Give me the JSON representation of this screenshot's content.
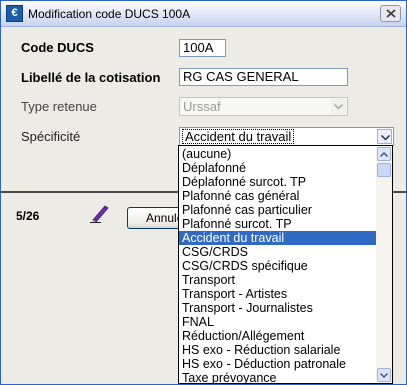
{
  "window": {
    "title": "Modification code DUCS 100A"
  },
  "form": {
    "code_label": "Code DUCS",
    "code_value": "100A",
    "libelle_label": "Libellé de la cotisation",
    "libelle_value": "RG CAS GENERAL",
    "type_label": "Type retenue",
    "type_value": "Urssaf",
    "specificite_label": "Spécificité",
    "specificite_value": "Accident du travail"
  },
  "footer": {
    "counter": "5/26",
    "cancel_label": "Annuler"
  },
  "dropdown": {
    "selected_index": 6,
    "items": [
      "(aucune)",
      "Déplafonné",
      "Déplafonné surcot. TP",
      "Plafonné cas général",
      "Plafonné cas particulier",
      "Plafonné surcot. TP",
      "Accident du travail",
      "CSG/CRDS",
      "CSG/CRDS spécifique",
      "Transport",
      "Transport - Artistes",
      "Transport - Journalistes",
      "FNAL",
      "Réduction/Allégement",
      "HS exo - Réduction salariale",
      "HS exo - Déduction patronale",
      "Taxe prévoyance"
    ]
  },
  "icons": {
    "app": "app-icon",
    "close": "close-icon",
    "edit": "pencil-icon",
    "combo_arrow": "chevron-down-icon",
    "scroll_up": "scroll-up-icon",
    "scroll_down": "scroll-down-icon"
  },
  "colors": {
    "selection": "#316ac5",
    "dialog_background": "#ecebe5",
    "title_gradient_end": "#c7d3ef"
  }
}
